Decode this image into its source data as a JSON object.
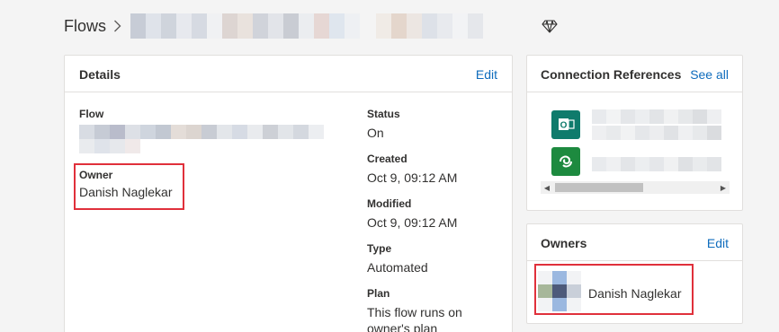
{
  "breadcrumb": {
    "root": "Flows"
  },
  "details": {
    "title": "Details",
    "edit_label": "Edit",
    "flow_label": "Flow",
    "owner_label": "Owner",
    "owner_value": "Danish Naglekar",
    "status_label": "Status",
    "status_value": "On",
    "created_label": "Created",
    "created_value": "Oct 9, 09:12 AM",
    "modified_label": "Modified",
    "modified_value": "Oct 9, 09:12 AM",
    "type_label": "Type",
    "type_value": "Automated",
    "plan_label": "Plan",
    "plan_value_line1": "This flow runs on",
    "plan_value_line2": "owner's plan"
  },
  "connections": {
    "title": "Connection References",
    "see_all_label": "See all",
    "items": [
      {
        "icon": "outlook-icon",
        "color": "#0f7b6c"
      },
      {
        "icon": "dataverse-icon",
        "color": "#1d8a3f"
      }
    ]
  },
  "owners": {
    "title": "Owners",
    "edit_label": "Edit",
    "items": [
      {
        "name": "Danish Naglekar"
      }
    ]
  },
  "colors": {
    "link": "#0f6cbd",
    "highlight": "#e0303b"
  }
}
